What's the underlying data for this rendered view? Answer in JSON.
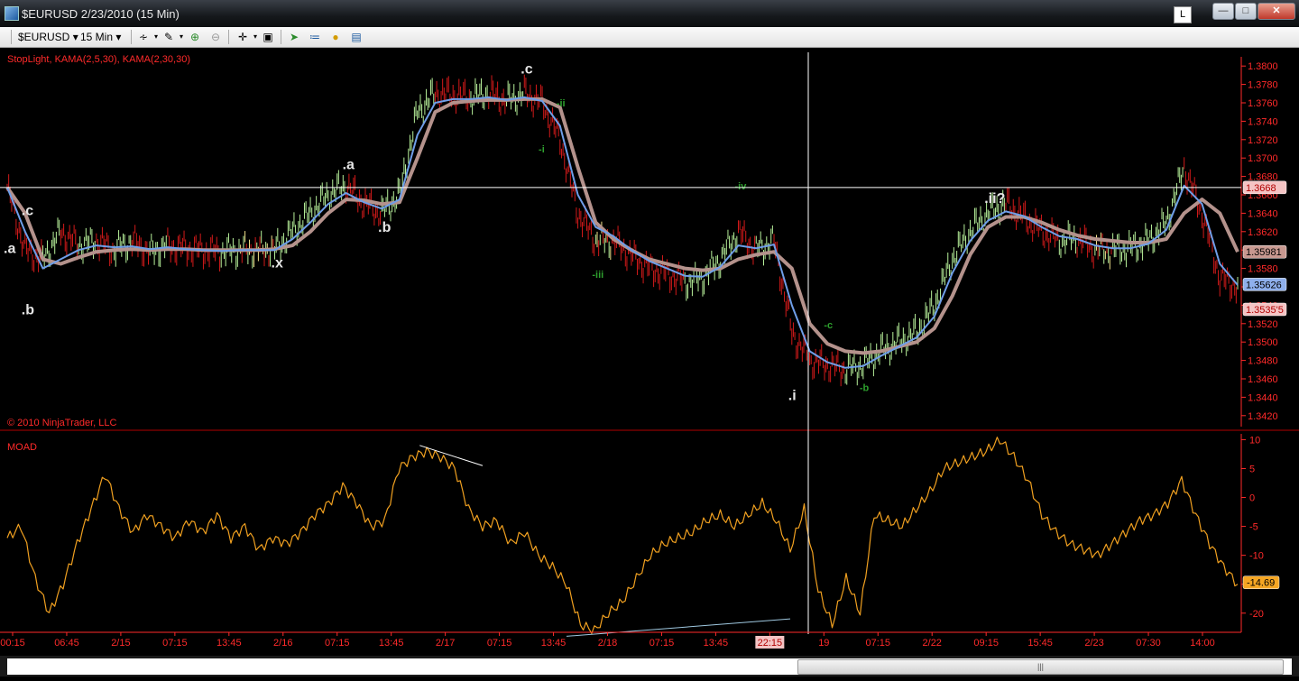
{
  "window": {
    "title": "$EURUSD  2/23/2010 (15 Min)",
    "layout_button": "L"
  },
  "toolbar": {
    "instrument": "$EURUSD",
    "interval": "15 Min"
  },
  "price_panel": {
    "indicator_label": "StopLight, KAMA(2,5,30), KAMA(2,30,30)",
    "copyright": "© 2010 NinjaTrader, LLC",
    "ylim": [
      1.341,
      1.381
    ],
    "ticks": [
      "1.3800",
      "1.3780",
      "1.3760",
      "1.3740",
      "1.3720",
      "1.3700",
      "1.3680",
      "1.3660",
      "1.3640",
      "1.3620",
      "1.3600",
      "1.3580",
      "1.3560",
      "1.3540",
      "1.3520",
      "1.3500",
      "1.3480",
      "1.3460",
      "1.3440",
      "1.3420"
    ],
    "price_flags": [
      {
        "text": "1.3668",
        "value": 1.3668,
        "kind": "cursor"
      },
      {
        "text": "1.35981",
        "value": 1.3598,
        "kind": "kama-slow"
      },
      {
        "text": "1.35626",
        "value": 1.35626,
        "kind": "kama-fast"
      },
      {
        "text": "1.3535'5",
        "value": 1.35355,
        "kind": "last"
      }
    ],
    "labels": [
      {
        "text": ".c",
        "x": 1,
        "y": 1.3638,
        "color": "white"
      },
      {
        "text": ".a",
        "x": 0,
        "y": 1.3597,
        "color": "white"
      },
      {
        "text": ".b",
        "x": 1,
        "y": 1.353,
        "color": "white"
      },
      {
        "text": ".x",
        "x": 15,
        "y": 1.3581,
        "color": "white"
      },
      {
        "text": ".a",
        "x": 19,
        "y": 1.3688,
        "color": "white"
      },
      {
        "text": ".b",
        "x": 21,
        "y": 1.362,
        "color": "white"
      },
      {
        "text": ".c",
        "x": 29,
        "y": 1.3792,
        "color": "white"
      },
      {
        "text": "-ii",
        "x": 31,
        "y": 1.3756,
        "color": "green"
      },
      {
        "text": "-i",
        "x": 30,
        "y": 1.3706,
        "color": "green"
      },
      {
        "text": "-iii",
        "x": 33,
        "y": 1.357,
        "color": "green"
      },
      {
        "text": "-iv",
        "x": 41,
        "y": 1.3666,
        "color": "green"
      },
      {
        "text": ".i",
        "x": 44,
        "y": 1.3437,
        "color": "white"
      },
      {
        "text": "-b",
        "x": 48,
        "y": 1.3447,
        "color": "green"
      },
      {
        "text": "-c",
        "x": 46,
        "y": 1.3515,
        "color": "green"
      },
      {
        "text": ".ii?",
        "x": 55,
        "y": 1.3651,
        "color": "white"
      }
    ]
  },
  "chart_data": {
    "type": "line",
    "x_tick_labels": [
      "00:15",
      "06:45",
      "2/15",
      "07:15",
      "13:45",
      "2/16",
      "07:15",
      "13:45",
      "2/17",
      "07:15",
      "13:45",
      "2/18",
      "07:15",
      "13:45",
      "22:15",
      "19",
      "07:15",
      "2/22",
      "09:15",
      "15:45",
      "2/23",
      "07:30",
      "14:00"
    ],
    "cursor_label": "22:15",
    "series": [
      {
        "name": "Price",
        "values": [
          1.3668,
          1.36,
          1.359,
          1.362,
          1.3605,
          1.361,
          1.36,
          1.361,
          1.3598,
          1.3605,
          1.3602,
          1.36,
          1.3598,
          1.36,
          1.36,
          1.36,
          1.362,
          1.364,
          1.366,
          1.367,
          1.365,
          1.364,
          1.366,
          1.375,
          1.377,
          1.3768,
          1.3765,
          1.377,
          1.3762,
          1.377,
          1.376,
          1.372,
          1.364,
          1.361,
          1.361,
          1.3595,
          1.358,
          1.3575,
          1.3565,
          1.357,
          1.359,
          1.362,
          1.36,
          1.361,
          1.351,
          1.348,
          1.3475,
          1.347,
          1.3475,
          1.349,
          1.35,
          1.351,
          1.354,
          1.359,
          1.362,
          1.364,
          1.365,
          1.3635,
          1.362,
          1.361,
          1.3612,
          1.36,
          1.36,
          1.3602,
          1.361,
          1.363,
          1.369,
          1.364,
          1.357,
          1.356
        ]
      },
      {
        "name": "KAMA(2,5,30)",
        "values": [
          1.3668,
          1.362,
          1.358,
          1.359,
          1.36,
          1.3605,
          1.3603,
          1.3604,
          1.3601,
          1.3603,
          1.3601,
          1.36,
          1.3599,
          1.36,
          1.36,
          1.36,
          1.3612,
          1.363,
          1.365,
          1.3662,
          1.3652,
          1.3645,
          1.3655,
          1.3725,
          1.376,
          1.3764,
          1.3764,
          1.3766,
          1.3763,
          1.3766,
          1.3762,
          1.3735,
          1.366,
          1.3625,
          1.3615,
          1.36,
          1.3588,
          1.358,
          1.3572,
          1.3571,
          1.3582,
          1.3605,
          1.3602,
          1.3606,
          1.354,
          1.349,
          1.3478,
          1.3472,
          1.3474,
          1.3485,
          1.3495,
          1.3505,
          1.3528,
          1.3575,
          1.361,
          1.3632,
          1.3642,
          1.3637,
          1.3625,
          1.3615,
          1.3612,
          1.3605,
          1.3602,
          1.3602,
          1.3607,
          1.3622,
          1.367,
          1.365,
          1.3585,
          1.3562
        ]
      },
      {
        "name": "KAMA(2,30,30)",
        "values": [
          1.3668,
          1.364,
          1.359,
          1.3585,
          1.3592,
          1.3598,
          1.36,
          1.3601,
          1.36,
          1.3601,
          1.3601,
          1.36,
          1.36,
          1.36,
          1.36,
          1.3601,
          1.3605,
          1.362,
          1.364,
          1.3655,
          1.3654,
          1.365,
          1.3652,
          1.37,
          1.375,
          1.376,
          1.3762,
          1.3763,
          1.3763,
          1.3764,
          1.3764,
          1.3755,
          1.369,
          1.363,
          1.3612,
          1.36,
          1.359,
          1.3585,
          1.358,
          1.3578,
          1.358,
          1.359,
          1.3595,
          1.3598,
          1.358,
          1.352,
          1.3498,
          1.349,
          1.3488,
          1.349,
          1.3495,
          1.35,
          1.3515,
          1.355,
          1.3595,
          1.3625,
          1.3636,
          1.3636,
          1.363,
          1.3622,
          1.3616,
          1.3612,
          1.361,
          1.3608,
          1.3608,
          1.3612,
          1.364,
          1.3655,
          1.364,
          1.3598
        ]
      }
    ]
  },
  "moad_panel": {
    "label": "MOAD",
    "ylim": [
      -23,
      11
    ],
    "ticks": [
      "10",
      "5",
      "0",
      "-5",
      "-10",
      "-15",
      "-20"
    ],
    "last_flag": "-14.69",
    "last_value": -14.69,
    "values": [
      -7,
      -5,
      -14,
      -20,
      -15,
      -8,
      -2,
      4,
      -2,
      -6,
      -3,
      -5,
      -7,
      -4,
      -6,
      -3,
      -7,
      -5,
      -9,
      -7,
      -8,
      -6,
      -3,
      -1,
      2,
      -1,
      -5,
      -4,
      5,
      7,
      8,
      7,
      5,
      -2,
      -5,
      -4,
      -8,
      -6,
      -10,
      -12,
      -15,
      -22,
      -23,
      -20,
      -18,
      -14,
      -10,
      -8,
      -7,
      -6,
      -4,
      -3,
      -5,
      -3,
      -1,
      -4,
      -9,
      -2,
      -16,
      -22,
      -14,
      -20,
      -3,
      -4,
      -5,
      -2,
      1,
      5,
      6,
      7,
      8,
      10,
      7,
      3,
      -3,
      -6,
      -8,
      -9,
      -10,
      -8,
      -6,
      -4,
      -3,
      -1,
      3,
      -3,
      -8,
      -12,
      -15
    ],
    "trend_lines": [
      {
        "x0": 29.5,
        "y0": 9,
        "x1": 34,
        "y1": 5.5,
        "color": "white"
      },
      {
        "x0": 40,
        "y0": -24,
        "x1": 56,
        "y1": -21,
        "color": "lightblue"
      }
    ]
  }
}
